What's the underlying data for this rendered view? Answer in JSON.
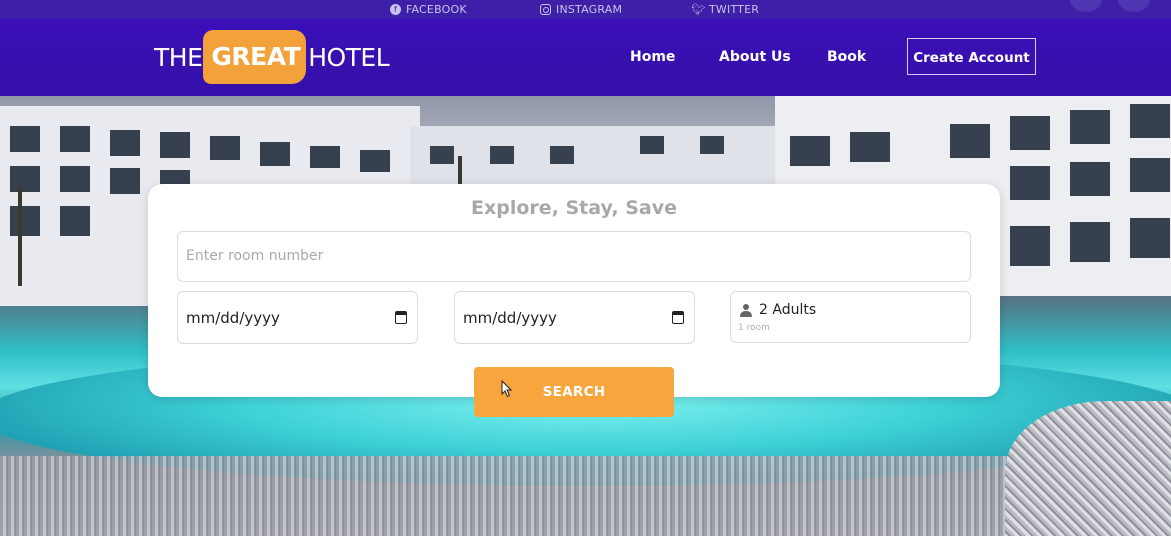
{
  "social": {
    "facebook": "FACEBOOK",
    "instagram": "INSTAGRAM",
    "twitter": "TWITTER"
  },
  "brand": {
    "prefix": "THE",
    "highlight": "GREAT",
    "suffix": "HOTEL",
    "accent_color": "#f3a13b",
    "nav_color": "#3a10b8"
  },
  "nav": {
    "home": "Home",
    "about": "About Us",
    "book": "Book",
    "create_account": "Create Account"
  },
  "search": {
    "title": "Explore, Stay, Save",
    "room_placeholder": "Enter room number",
    "check_in": "mm/dd/yyyy",
    "check_out": "mm/dd/yyyy",
    "guests": "2 Adults",
    "rooms": "1 room",
    "button": "SEARCH"
  },
  "icons": [
    "facebook-icon",
    "instagram-icon",
    "twitter-icon",
    "calendar-icon",
    "person-icon",
    "mouse-cursor-icon"
  ]
}
